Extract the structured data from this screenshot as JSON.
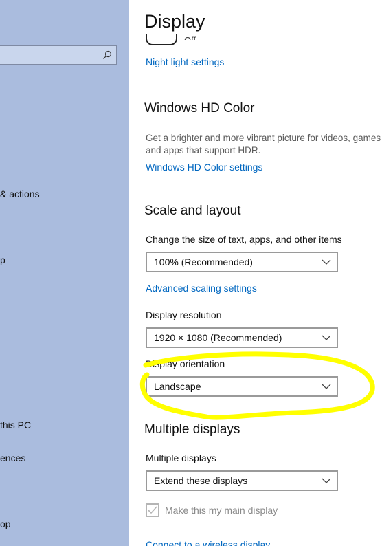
{
  "sidebar": {
    "search": {
      "placeholder": ""
    },
    "items": [
      {
        "label": "& actions"
      },
      {
        "label": "p"
      },
      {
        "label": "this PC"
      },
      {
        "label": "ences"
      },
      {
        "label": "op"
      }
    ]
  },
  "main": {
    "title": "Display",
    "night_light": {
      "toggle_state": "Off",
      "settings_link": "Night light settings"
    },
    "hd_color": {
      "heading": "Windows HD Color",
      "description": "Get a brighter and more vibrant picture for videos, games and apps that support HDR.",
      "settings_link": "Windows HD Color settings"
    },
    "scale_layout": {
      "heading": "Scale and layout",
      "scale_label": "Change the size of text, apps, and other items",
      "scale_value": "100% (Recommended)",
      "advanced_link": "Advanced scaling settings",
      "resolution_label": "Display resolution",
      "resolution_value": "1920 × 1080 (Recommended)",
      "orientation_label": "Display orientation",
      "orientation_value": "Landscape"
    },
    "multiple_displays": {
      "heading": "Multiple displays",
      "label": "Multiple displays",
      "value": "Extend these displays",
      "main_display_checkbox": "Make this my main display",
      "connect_link": "Connect to a wireless display"
    }
  },
  "colors": {
    "sidebar_bg": "#aabcde",
    "link": "#0067c0",
    "annotation_highlight": "#ffff00"
  }
}
